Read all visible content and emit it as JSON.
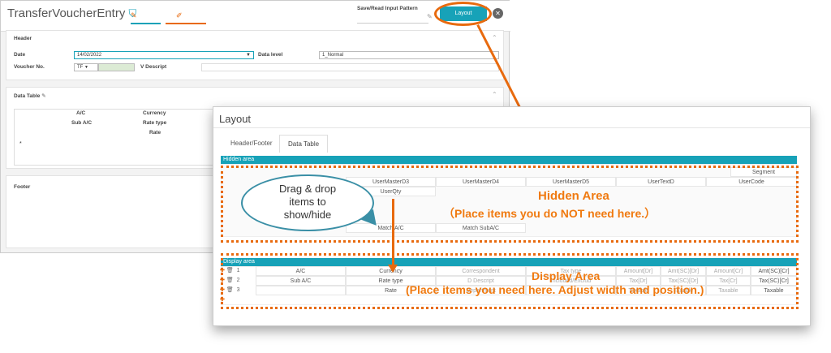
{
  "bg_window": {
    "title": "TransferVoucherEntry",
    "save_read_label": "Save/Read Input Pattern",
    "layout_button": "Layout",
    "header": {
      "section_title": "Header",
      "date_label": "Date",
      "date_value": "14/02/2022",
      "data_level_label": "Data level",
      "data_level_value": "1_Normal",
      "voucher_label": "Voucher No.",
      "voucher_value": "TF",
      "vdesc_label": "V Descript"
    },
    "data_table": {
      "section_title": "Data Table",
      "col_ac": "A/C",
      "col_currency": "Currency",
      "col_subac": "Sub A/C",
      "col_ratetype": "Rate type",
      "col_rate": "Rate",
      "row_marker": "*"
    },
    "footer": {
      "section_title": "Footer"
    }
  },
  "dialog": {
    "title": "Layout",
    "tabs": [
      "Header/Footer",
      "Data Table"
    ],
    "hidden_bar": "Hidden area",
    "hidden_cells": {
      "segment": "Segment",
      "umd3": "UserMasterD3",
      "umd4": "UserMasterD4",
      "umd5": "UserMasterD5",
      "utd": "UserTextD",
      "ucode": "UserCode",
      "uqty": "UserQty",
      "match_ac": "Match A/C",
      "match_subac": "Match SubA/C"
    },
    "display_bar": "Display area",
    "rows": [
      "1",
      "2",
      "3"
    ],
    "row1": [
      "A/C",
      "Currency",
      "Correspondent",
      "Tax type",
      "Amount[Dr]",
      "Amt(SC)[Dr]",
      "Amount[Cr]",
      "Amt(SC)[Cr]"
    ],
    "row2": [
      "Sub A/C",
      "Rate type",
      "D Descript",
      "Included/Exclud",
      "Tax[Dr]",
      "Tax(SC)[Dr]",
      "Tax[Cr]",
      "Tax(SC)[Cr]"
    ],
    "row3": [
      "",
      "Rate",
      "Department",
      "",
      "Taxable",
      "Taxable",
      "Taxable",
      "Taxable"
    ]
  },
  "annotations": {
    "bubble": "Drag & drop items to show/hide",
    "hidden_title": "Hidden Area",
    "hidden_sub": "（Place items you do NOT need here.）",
    "display_title": "Display Area",
    "display_sub": "(Place items you need here. Adjust width and position.)"
  },
  "colors": {
    "accent": "#17a2b8",
    "annotation": "#e86a0e"
  }
}
